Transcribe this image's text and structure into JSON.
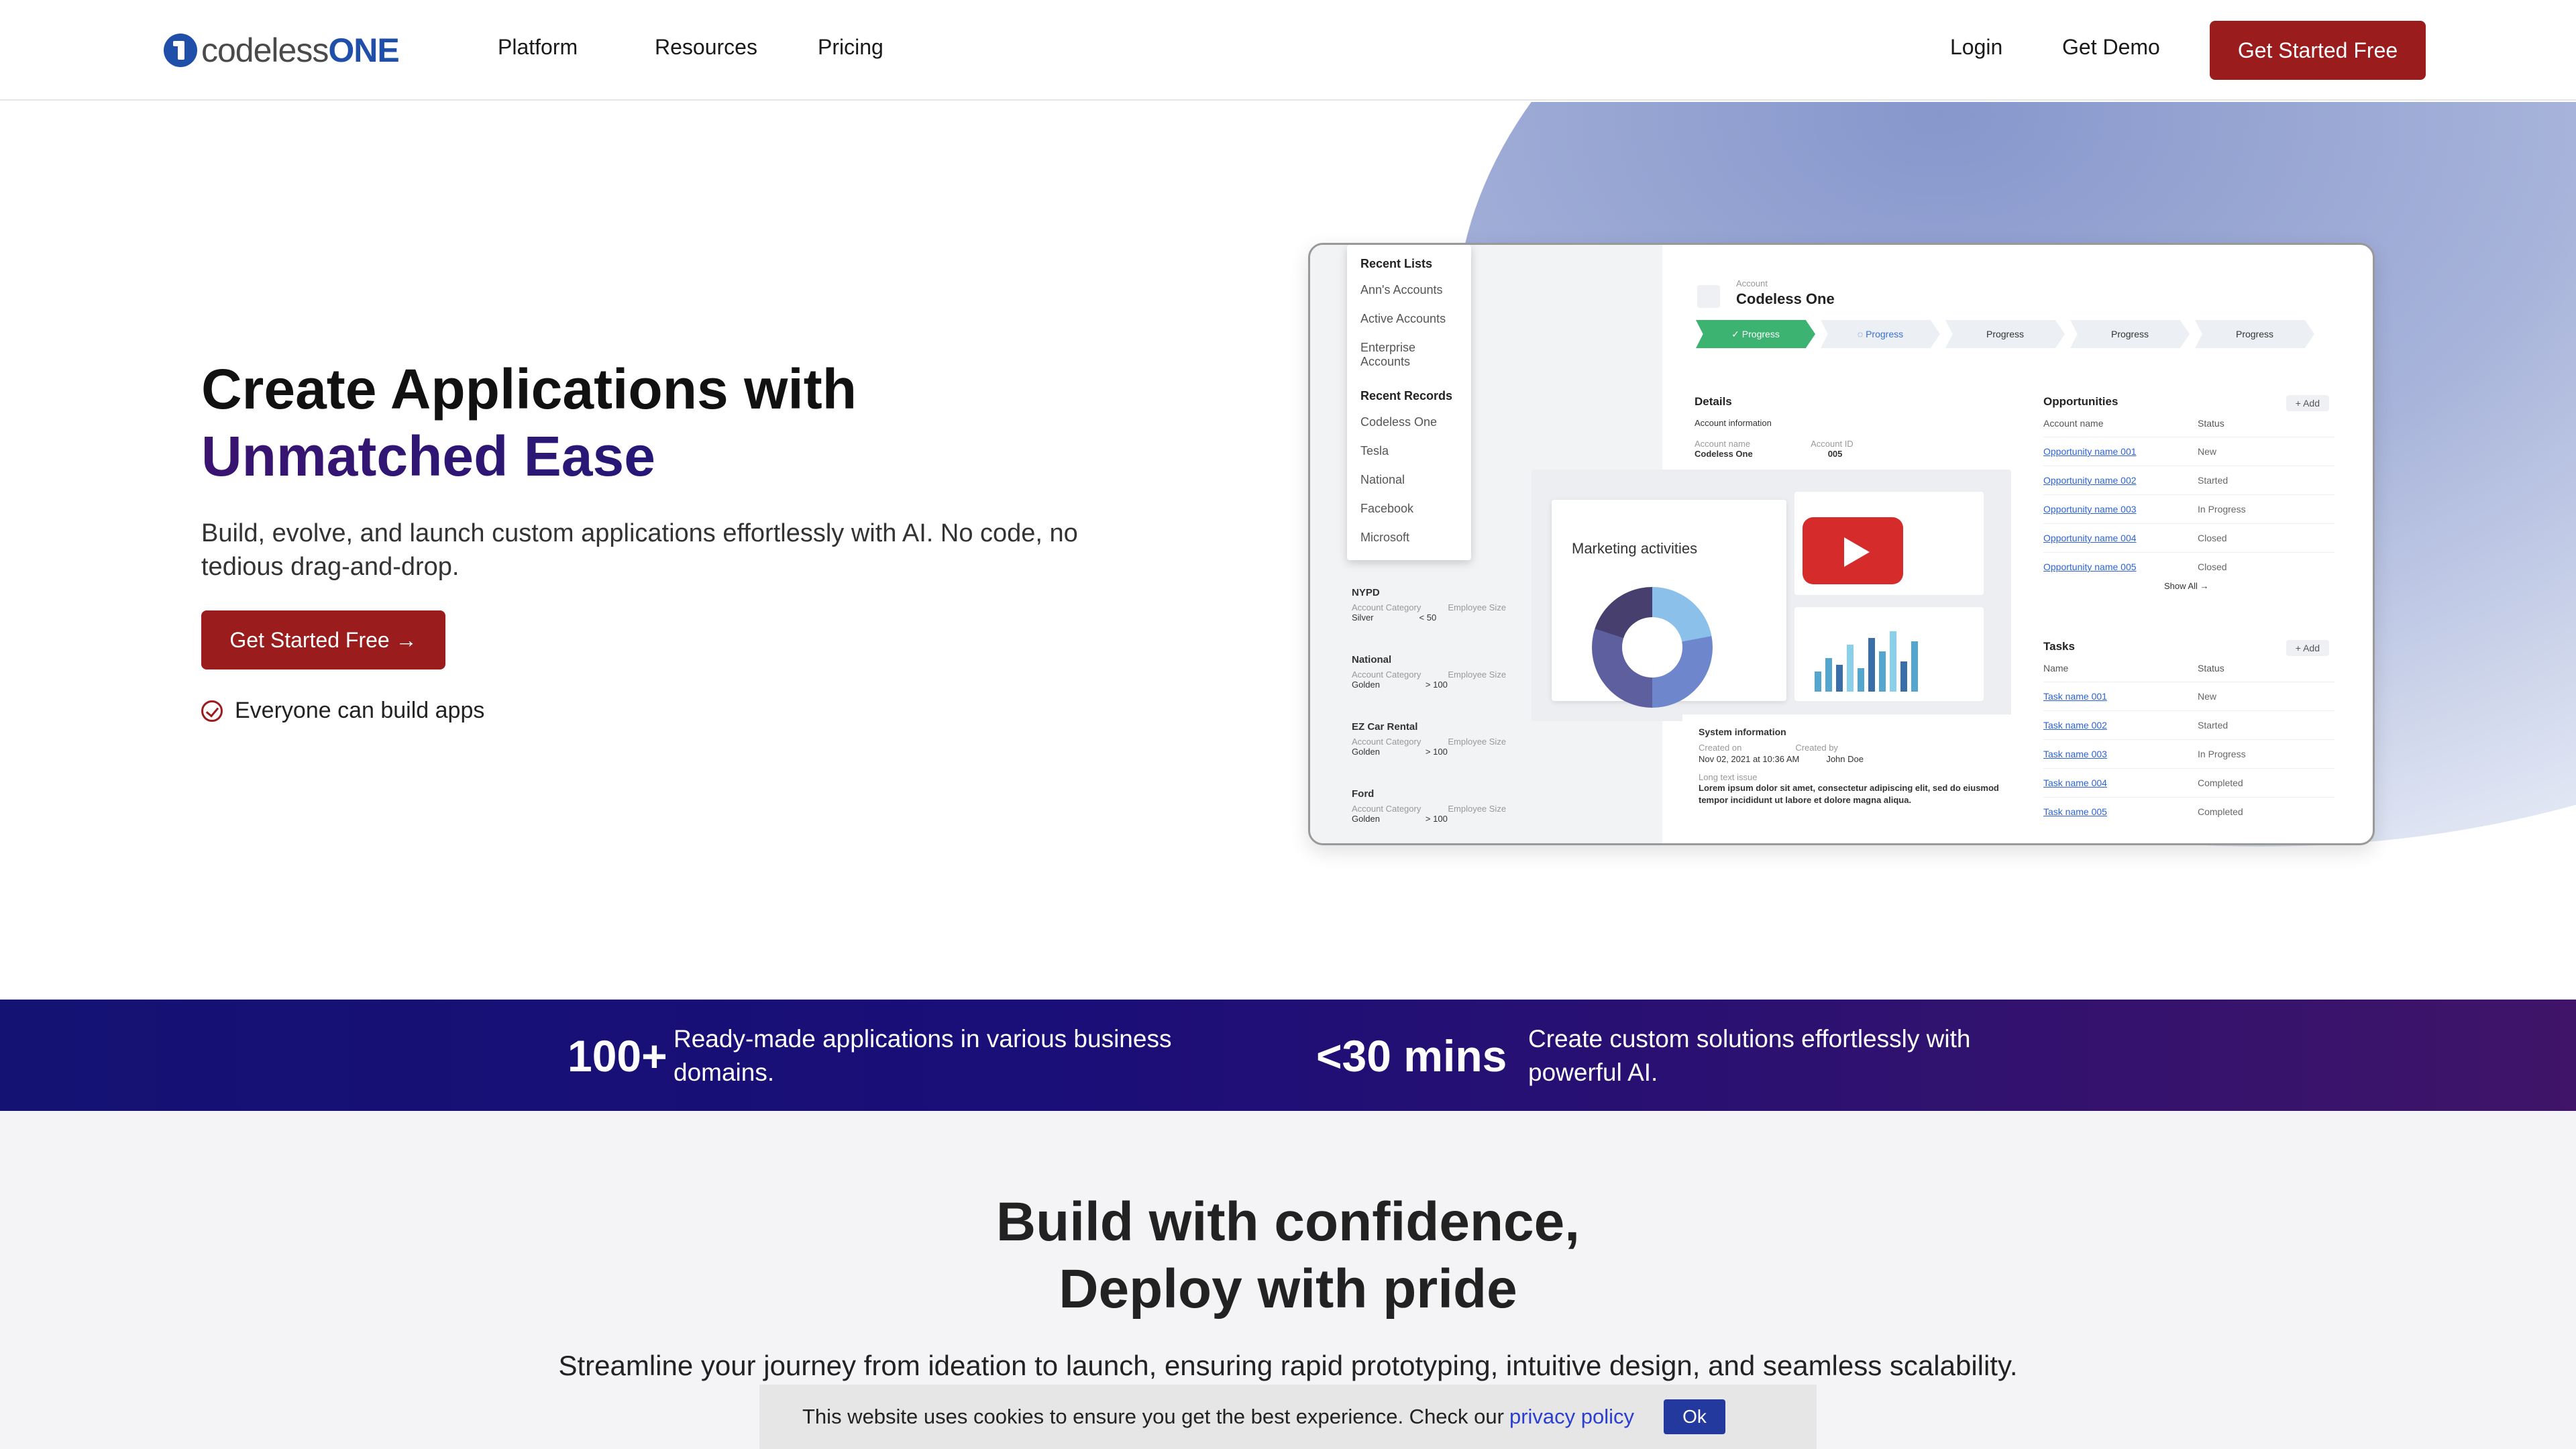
{
  "nav": {
    "logo_prefix": "codeless",
    "logo_suffix": "ONE",
    "links": [
      "Platform",
      "Resources",
      "Pricing"
    ],
    "login": "Login",
    "demo": "Get Demo",
    "cta": "Get Started Free"
  },
  "hero": {
    "title_line1": "Create Applications with",
    "title_line2": "Unmatched Ease",
    "subtitle": "Build, evolve, and launch custom applications effortlessly with AI. No code, no tedious drag-and-drop.",
    "cta": "Get Started Free →",
    "check_text": "Everyone can build apps"
  },
  "mock": {
    "recent_lists_title": "Recent Lists",
    "recent_lists": [
      "Ann's Accounts",
      "Active Accounts",
      "Enterprise Accounts"
    ],
    "recent_records_title": "Recent Records",
    "recent_records": [
      "Codeless One",
      "Tesla",
      "National",
      "Facebook",
      "Microsoft"
    ],
    "left_records": [
      {
        "name": "NYPD",
        "l1": "Account Category",
        "l2": "Employee Size",
        "v1": "Silver",
        "v2": "< 50"
      },
      {
        "name": "National",
        "l1": "Account Category",
        "l2": "Employee Size",
        "v1": "Golden",
        "v2": "> 100"
      },
      {
        "name": "EZ Car Rental",
        "l1": "Account Category",
        "l2": "Employee Size",
        "v1": "Golden",
        "v2": "> 100"
      },
      {
        "name": "Ford",
        "l1": "Account Category",
        "l2": "Employee Size",
        "v1": "Golden",
        "v2": "> 100"
      }
    ],
    "account_label": "Account",
    "account_name": "Codeless One",
    "steps": [
      "✓ Progress",
      "◌ Progress",
      "Progress",
      "Progress",
      "Progress"
    ],
    "details_title": "Details",
    "account_info": "Account information",
    "account_name_label": "Account name",
    "account_id_label": "Account ID",
    "account_id": "005",
    "chart_title": "Marketing activities",
    "opps_title": "Opportunities",
    "add_label": "+ Add",
    "opps_headers": [
      "Account name",
      "Status"
    ],
    "opps": [
      {
        "name": "Opportunity name 001",
        "status": "New"
      },
      {
        "name": "Opportunity name 002",
        "status": "Started"
      },
      {
        "name": "Opportunity name 003",
        "status": "In Progress"
      },
      {
        "name": "Opportunity name 004",
        "status": "Closed"
      },
      {
        "name": "Opportunity name 005",
        "status": "Closed"
      }
    ],
    "show_all": "Show All →",
    "tasks_title": "Tasks",
    "tasks_headers": [
      "Name",
      "Status"
    ],
    "tasks": [
      {
        "name": "Task name 001",
        "status": "New"
      },
      {
        "name": "Task name 002",
        "status": "Started"
      },
      {
        "name": "Task name 003",
        "status": "In Progress"
      },
      {
        "name": "Task name 004",
        "status": "Completed"
      },
      {
        "name": "Task name 005",
        "status": "Completed"
      }
    ],
    "sys_title": "System information",
    "created_on_label": "Created on",
    "created_on": "Nov 02, 2021 at 10:36 AM",
    "created_by_label": "Created by",
    "created_by": "John Doe",
    "long_text_label": "Long text issue",
    "long_text": "Lorem ipsum dolor sit amet, consectetur adipiscing elit, sed do eiusmod tempor incididunt ut labore et dolore magna aliqua."
  },
  "stats": [
    {
      "num": "100+",
      "text": "Ready-made applications in various business domains."
    },
    {
      "num": "<30 mins",
      "text": "Create custom solutions effortlessly with powerful AI."
    }
  ],
  "section2": {
    "title_line1": "Build with confidence,",
    "title_line2": "Deploy with pride",
    "subtitle": "Streamline your journey from ideation to launch, ensuring rapid prototyping, intuitive design, and seamless scalability."
  },
  "cookie": {
    "text": "This website uses cookies to ensure you get the best experience. Check our",
    "link": "privacy policy",
    "ok": "Ok"
  },
  "colors": {
    "brand_red": "#9b1c1c",
    "brand_blue": "#1f4fa8",
    "band_start": "#141273",
    "band_end": "#3f1469"
  }
}
